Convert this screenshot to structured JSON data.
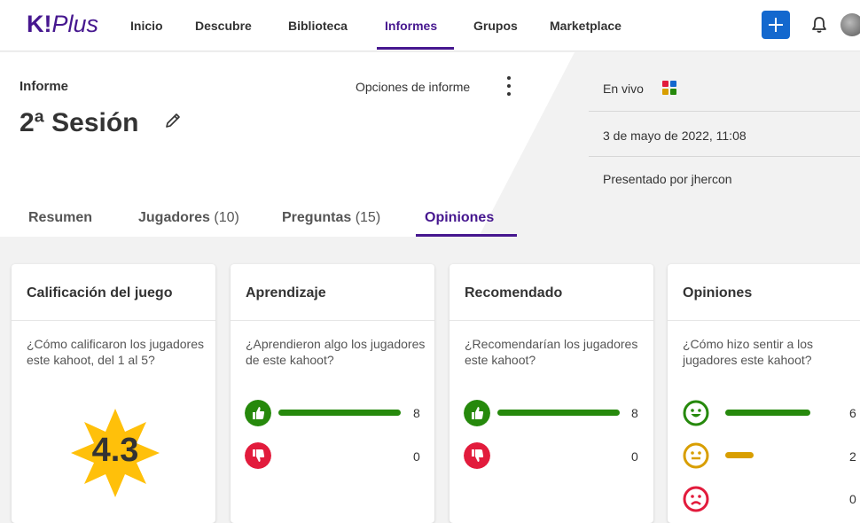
{
  "brand": {
    "logo_k": "K!",
    "logo_plus": "Plus"
  },
  "nav": {
    "items": [
      "Inicio",
      "Descubre",
      "Biblioteca",
      "Informes",
      "Grupos",
      "Marketplace"
    ],
    "active": "Informes"
  },
  "report": {
    "label": "Informe",
    "title": "2ª Sesión",
    "options_label": "Opciones de informe",
    "mode": "En vivo",
    "date": "3 de mayo de 2022, 11:08",
    "host": "Presentado por jhercon"
  },
  "tabs": [
    {
      "label": "Resumen",
      "count": ""
    },
    {
      "label": "Jugadores",
      "count": "(10)"
    },
    {
      "label": "Preguntas",
      "count": "(15)"
    },
    {
      "label": "Opiniones",
      "count": ""
    }
  ],
  "active_tab": "Opiniones",
  "cards": {
    "rating": {
      "title": "Calificación del juego",
      "question": "¿Cómo calificaron los jugadores este kahoot, del 1 al 5?",
      "value": "4.3"
    },
    "learning": {
      "title": "Aprendizaje",
      "question": "¿Aprendieron algo los jugadores de este kahoot?",
      "yes": 8,
      "no": 0,
      "max": 8
    },
    "recommend": {
      "title": "Recomendado",
      "question": "¿Recomendarían los jugadores este kahoot?",
      "yes": 8,
      "no": 0,
      "max": 8
    },
    "feelings": {
      "title": "Opiniones",
      "question": "¿Cómo hizo sentir a los jugadores este kahoot?",
      "positive": 6,
      "neutral": 2,
      "negative": 0,
      "max": 6
    }
  },
  "colors": {
    "brand_purple": "#46178f",
    "green": "#26890c",
    "red": "#e21b3c",
    "yellow": "#d89e00",
    "star": "#ffc00a",
    "add_blue": "#1368ce"
  },
  "icons": [
    "plus-icon",
    "bell-icon",
    "pencil-icon",
    "kebab-icon",
    "live-grid-icon",
    "thumbs-up-icon",
    "thumbs-down-icon",
    "happy-face-icon",
    "neutral-face-icon",
    "sad-face-icon"
  ]
}
